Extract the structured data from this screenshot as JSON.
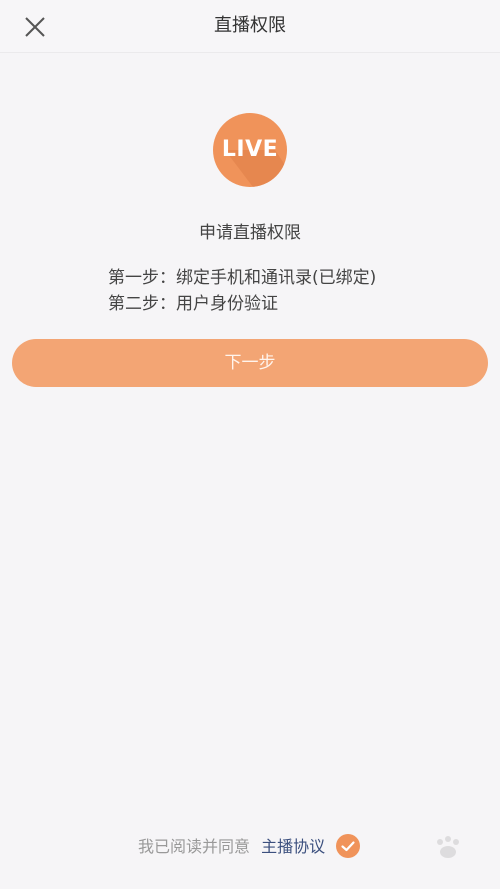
{
  "header": {
    "title": "直播权限",
    "close_icon": "close-icon"
  },
  "logo": {
    "text": "LIVE",
    "color": "#f0935a"
  },
  "main": {
    "title": "申请直播权限",
    "steps": [
      "第一步：绑定手机和通讯录(已绑定)",
      "第二步：用户身份验证"
    ],
    "next_button": "下一步",
    "button_color": "#f3a574"
  },
  "agreement": {
    "prefix": "我已阅读并同意",
    "link": "主播协议",
    "checked": true,
    "check_icon": "check-circle-icon"
  }
}
